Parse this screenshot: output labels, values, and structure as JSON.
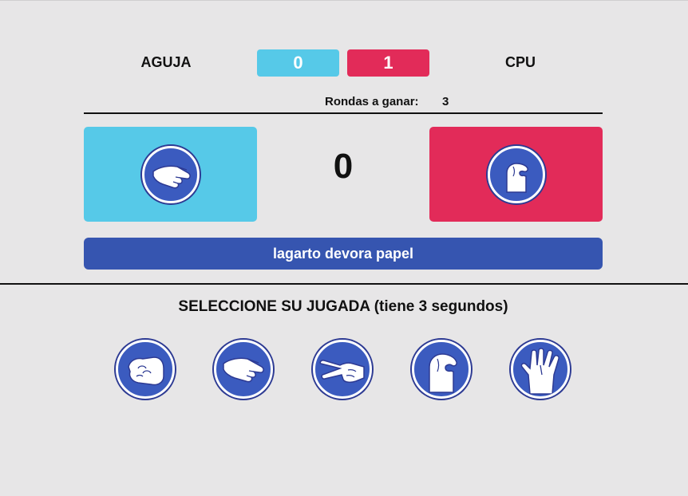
{
  "colors": {
    "player": "#56c9e8",
    "cpu": "#e22b59",
    "accent": "#3655b0",
    "hand_circle": "#3b5bbf"
  },
  "scoreboard": {
    "player_name": "AGUJA",
    "player_score": "0",
    "cpu_score": "1",
    "cpu_name": "CPU"
  },
  "rounds": {
    "label": "Rondas a ganar:",
    "value": "3"
  },
  "arena": {
    "player_hand_icon": "paper-hand-icon",
    "counter": "0",
    "cpu_hand_icon": "lizard-hand-icon"
  },
  "result": {
    "text": "lagarto devora papel"
  },
  "selection": {
    "prompt": "SELECCIONE SU JUGADA (tiene 3 segundos)",
    "choices": [
      {
        "icon": "rock-hand-icon"
      },
      {
        "icon": "paper-hand-icon"
      },
      {
        "icon": "scissors-hand-icon"
      },
      {
        "icon": "lizard-hand-icon"
      },
      {
        "icon": "spock-hand-icon"
      }
    ]
  }
}
